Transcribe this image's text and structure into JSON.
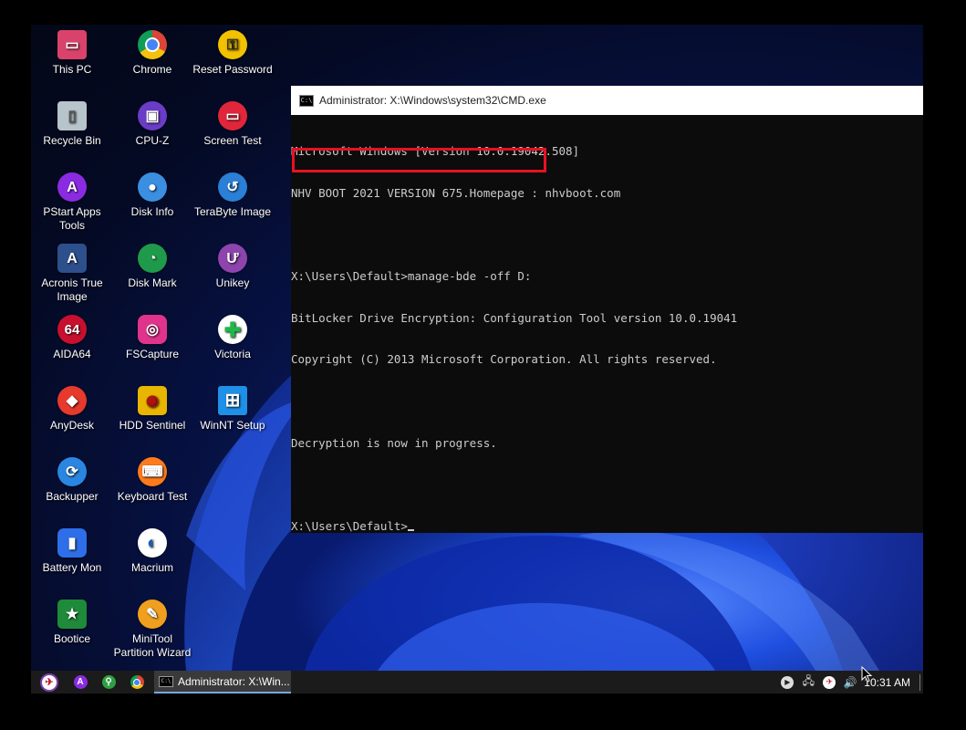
{
  "desktop": {
    "icons": [
      {
        "label": "This PC",
        "icon": "monitor-icon",
        "color": "#d9436b",
        "glyph": "▭"
      },
      {
        "label": "Chrome",
        "icon": "chrome-icon",
        "color": "#e0a30a",
        "glyph": "●"
      },
      {
        "label": "Reset Password",
        "icon": "padlock-icon",
        "color": "#f2c200",
        "glyph": "⚿"
      },
      {
        "label": "Recycle Bin",
        "icon": "recycle-bin-icon",
        "color": "#b8c4cc",
        "glyph": "▯"
      },
      {
        "label": "CPU-Z",
        "icon": "cpu-icon",
        "color": "#6a3cc8",
        "glyph": "▣"
      },
      {
        "label": "Screen Test",
        "icon": "screen-test-icon",
        "color": "#e0263a",
        "glyph": "▭"
      },
      {
        "label": "PStart Apps Tools",
        "icon": "apps-icon",
        "color": "#8a2be2",
        "glyph": "A"
      },
      {
        "label": "Disk Info",
        "icon": "disk-info-icon",
        "color": "#3a8fe0",
        "glyph": "●"
      },
      {
        "label": "TeraByte Image",
        "icon": "clock-restore-icon",
        "color": "#2a7fd6",
        "glyph": "↺"
      },
      {
        "label": "Acronis True Image",
        "icon": "acronis-icon",
        "color": "#2d4f8c",
        "glyph": "A"
      },
      {
        "label": "Disk Mark",
        "icon": "disk-mark-icon",
        "color": "#1f9a4a",
        "glyph": "◔"
      },
      {
        "label": "Unikey",
        "icon": "keyboard-key-icon",
        "color": "#8e44ad",
        "glyph": "Ư"
      },
      {
        "label": "AIDA64",
        "icon": "aida64-icon",
        "color": "#c8102e",
        "glyph": "64"
      },
      {
        "label": "FSCapture",
        "icon": "camera-icon",
        "color": "#e0348c",
        "glyph": "◎"
      },
      {
        "label": "Victoria",
        "icon": "green-cross-icon",
        "color": "#ffffff",
        "glyph": "✚"
      },
      {
        "label": "AnyDesk",
        "icon": "anydesk-icon",
        "color": "#e8392d",
        "glyph": "◆"
      },
      {
        "label": "HDD Sentinel",
        "icon": "hdd-sentinel-icon",
        "color": "#e8b500",
        "glyph": "◉"
      },
      {
        "label": "WinNT Setup",
        "icon": "windows-logo-icon",
        "color": "#1e90e8",
        "glyph": "⊞"
      },
      {
        "label": "Backupper",
        "icon": "backup-icon",
        "color": "#2a86e0",
        "glyph": "⟳"
      },
      {
        "label": "Keyboard Test",
        "icon": "keyboard-icon",
        "color": "#ff7a1a",
        "glyph": "⌨"
      },
      {
        "label": "Battery Mon",
        "icon": "battery-icon",
        "color": "#2e6ee8",
        "glyph": "▮"
      },
      {
        "label": "Macrium",
        "icon": "macrium-icon",
        "color": "#ffffff",
        "glyph": "◐"
      },
      {
        "label": "Bootice",
        "icon": "bootice-icon",
        "color": "#1f8a3a",
        "glyph": "★"
      },
      {
        "label": "MiniTool Partition Wizard",
        "icon": "minitool-icon",
        "color": "#f0a01e",
        "glyph": "✎"
      }
    ]
  },
  "cmd_window": {
    "title": "Administrator: X:\\Windows\\system32\\CMD.exe",
    "lines": [
      "Microsoft Windows [Version 10.0.19042.508]",
      "NHV BOOT 2021 VERSION 675.Homepage : nhvboot.com",
      "",
      "X:\\Users\\Default>manage-bde -off D:",
      "BitLocker Drive Encryption: Configuration Tool version 10.0.19041",
      "Copyright (C) 2013 Microsoft Corporation. All rights reserved.",
      "",
      "Decryption is now in progress.",
      "",
      "X:\\Users\\Default>"
    ],
    "highlight_color": "#e81123"
  },
  "taskbar": {
    "start_icon": "start-logo-icon",
    "pinned": [
      {
        "icon": "pstart-icon",
        "color": "#8a2be2",
        "glyph": "A"
      },
      {
        "icon": "search-everything-icon",
        "color": "#2ea043",
        "glyph": "⚲"
      },
      {
        "icon": "chrome-icon",
        "color": "#e0a30a",
        "glyph": "●"
      }
    ],
    "active_task": "Administrator: X:\\Win...",
    "tray_icons": [
      "media-play-icon",
      "network-icon",
      "nhv-boot-icon",
      "volume-icon"
    ],
    "clock": "10:31 AM"
  }
}
